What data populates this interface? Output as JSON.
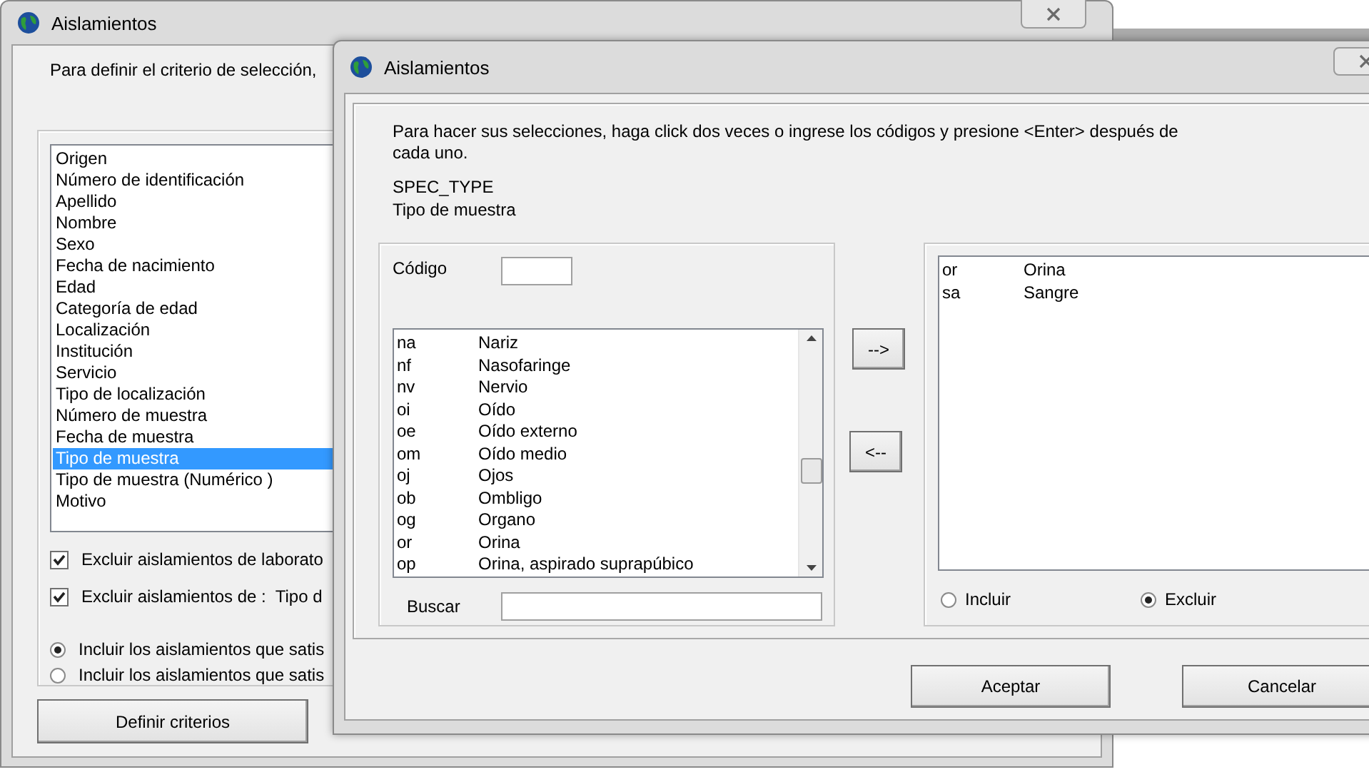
{
  "back_window": {
    "title": "Aislamientos",
    "intro": "Para definir el criterio de selección,",
    "fields": [
      {
        "label": "Origen",
        "selected": false
      },
      {
        "label": "Número de identificación",
        "selected": false
      },
      {
        "label": "Apellido",
        "selected": false
      },
      {
        "label": "Nombre",
        "selected": false
      },
      {
        "label": "Sexo",
        "selected": false
      },
      {
        "label": "Fecha de nacimiento",
        "selected": false
      },
      {
        "label": "Edad",
        "selected": false
      },
      {
        "label": "Categoría de edad",
        "selected": false
      },
      {
        "label": "Localización",
        "selected": false
      },
      {
        "label": "Institución",
        "selected": false
      },
      {
        "label": "Servicio",
        "selected": false
      },
      {
        "label": "Tipo de localización",
        "selected": false
      },
      {
        "label": "Número de muestra",
        "selected": false
      },
      {
        "label": "Fecha de muestra",
        "selected": false
      },
      {
        "label": "Tipo de muestra",
        "selected": true
      },
      {
        "label": "Tipo de muestra (Numérico )",
        "selected": false
      },
      {
        "label": "Motivo",
        "selected": false
      }
    ],
    "checkboxes": [
      {
        "label": "Excluir aislamientos de laborato",
        "checked": true
      },
      {
        "label": "Excluir aislamientos de :  Tipo d",
        "checked": true
      }
    ],
    "radios": [
      {
        "label": "Incluir los aislamientos que satis",
        "selected": true
      },
      {
        "label": "Incluir los aislamientos que satis",
        "selected": false
      }
    ],
    "buttons": [
      "Definir criterios"
    ]
  },
  "dialog": {
    "title": "Aislamientos",
    "instructions": "Para hacer sus selecciones, haga click dos veces o ingrese los códigos y presione <Enter> después de cada uno.",
    "field_code": "SPEC_TYPE",
    "field_name": "Tipo de muestra",
    "code_label": "Código",
    "search_label": "Buscar",
    "available": [
      {
        "code": "na",
        "name": "Nariz"
      },
      {
        "code": "nf",
        "name": "Nasofaringe"
      },
      {
        "code": "nv",
        "name": "Nervio"
      },
      {
        "code": "oi",
        "name": "Oído"
      },
      {
        "code": "oe",
        "name": "Oído externo"
      },
      {
        "code": "om",
        "name": "Oído medio"
      },
      {
        "code": "oj",
        "name": "Ojos"
      },
      {
        "code": "ob",
        "name": "Ombligo"
      },
      {
        "code": "og",
        "name": "Organo"
      },
      {
        "code": "or",
        "name": "Orina"
      },
      {
        "code": "op",
        "name": "Orina, aspirado suprapúbico"
      }
    ],
    "add_button": "-->",
    "remove_button": "<--",
    "chosen": [
      {
        "code": "or",
        "name": "Orina"
      },
      {
        "code": "sa",
        "name": "Sangre"
      }
    ],
    "mode_options": [
      {
        "label": "Incluir",
        "selected": false
      },
      {
        "label": "Excluir",
        "selected": true
      }
    ],
    "buttons": [
      "Aceptar",
      "Cancelar"
    ]
  }
}
